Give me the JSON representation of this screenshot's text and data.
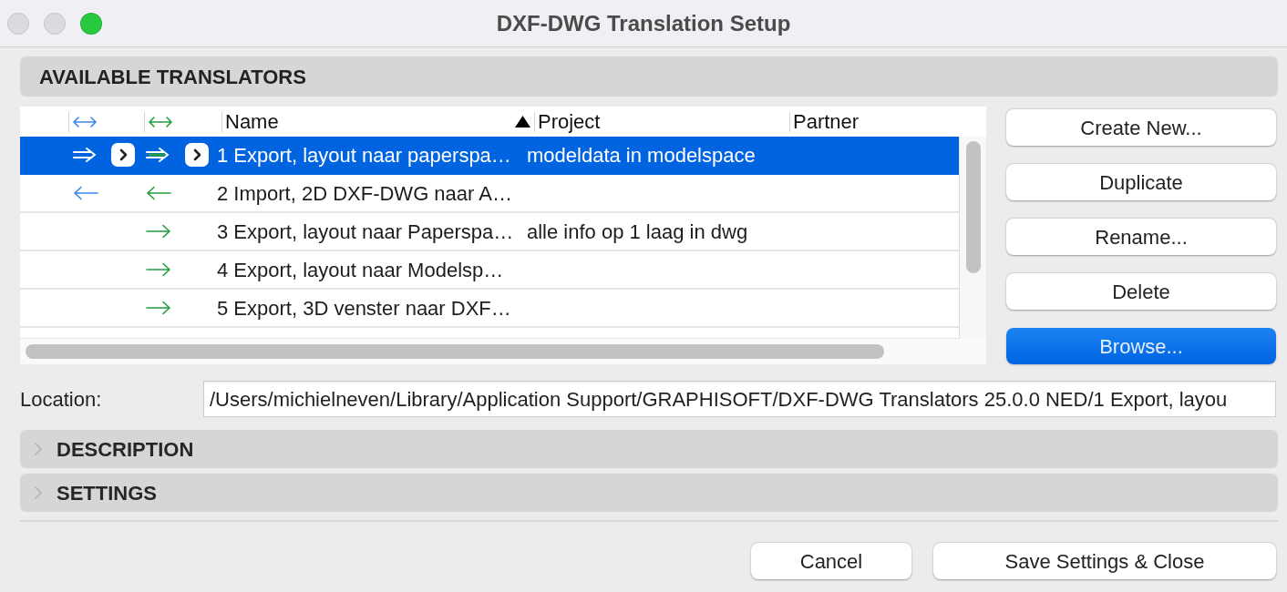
{
  "window": {
    "title": "DXF-DWG Translation Setup",
    "buttons": [
      {
        "kind": "close",
        "enabled": false
      },
      {
        "kind": "minimize",
        "enabled": false
      },
      {
        "kind": "zoom",
        "enabled": true
      }
    ]
  },
  "translators": {
    "title": "AVAILABLE TRANSLATORS",
    "columns": [
      {
        "label": "Name",
        "sorted": true
      },
      {
        "label": "Project",
        "sorted": false
      },
      {
        "label": "Partner",
        "sorted": false
      }
    ],
    "rows": [
      {
        "arrows": [
          {
            "kind": "right"
          },
          {
            "kind": "right"
          }
        ],
        "name": "1 Export, layout naar paperspa…",
        "project": "modeldata in modelspace",
        "selected": true
      },
      {
        "arrows": [
          {
            "kind": "left"
          },
          {
            "kind": "left"
          }
        ],
        "name": "2 Import, 2D DXF-DWG naar A…",
        "selected": false
      },
      {
        "arrows": [
          {
            "kind": "none"
          },
          {
            "kind": "right"
          }
        ],
        "name": "3 Export, layout naar Paperspa…",
        "project": "alle info op 1 laag in dwg",
        "selected": false
      },
      {
        "arrows": [
          {
            "kind": "none"
          },
          {
            "kind": "right"
          }
        ],
        "name": "4 Export, layout naar Modelsp…",
        "selected": false
      },
      {
        "arrows": [
          {
            "kind": "none"
          },
          {
            "kind": "right"
          }
        ],
        "name": "5 Export, 3D venster naar DXF…",
        "selected": false
      }
    ]
  },
  "actions": [
    {
      "label": "Create New...",
      "kind": "default"
    },
    {
      "label": "Duplicate",
      "kind": "default"
    },
    {
      "label": "Rename...",
      "kind": "default"
    },
    {
      "label": "Delete",
      "kind": "default"
    },
    {
      "label": "Browse...",
      "kind": "primary"
    }
  ],
  "location": {
    "label": "Location:",
    "value": "/Users/michielneven/Library/Application Support/GRAPHISOFT/DXF-DWG Translators 25.0.0 NED/1 Export, layou"
  },
  "sections": [
    {
      "title": "DESCRIPTION",
      "expanded": false
    },
    {
      "title": "SETTINGS",
      "expanded": false
    }
  ],
  "footer_buttons": [
    {
      "label": "Cancel",
      "kind": "default"
    },
    {
      "label": "Save Settings & Close",
      "kind": "default"
    }
  ]
}
